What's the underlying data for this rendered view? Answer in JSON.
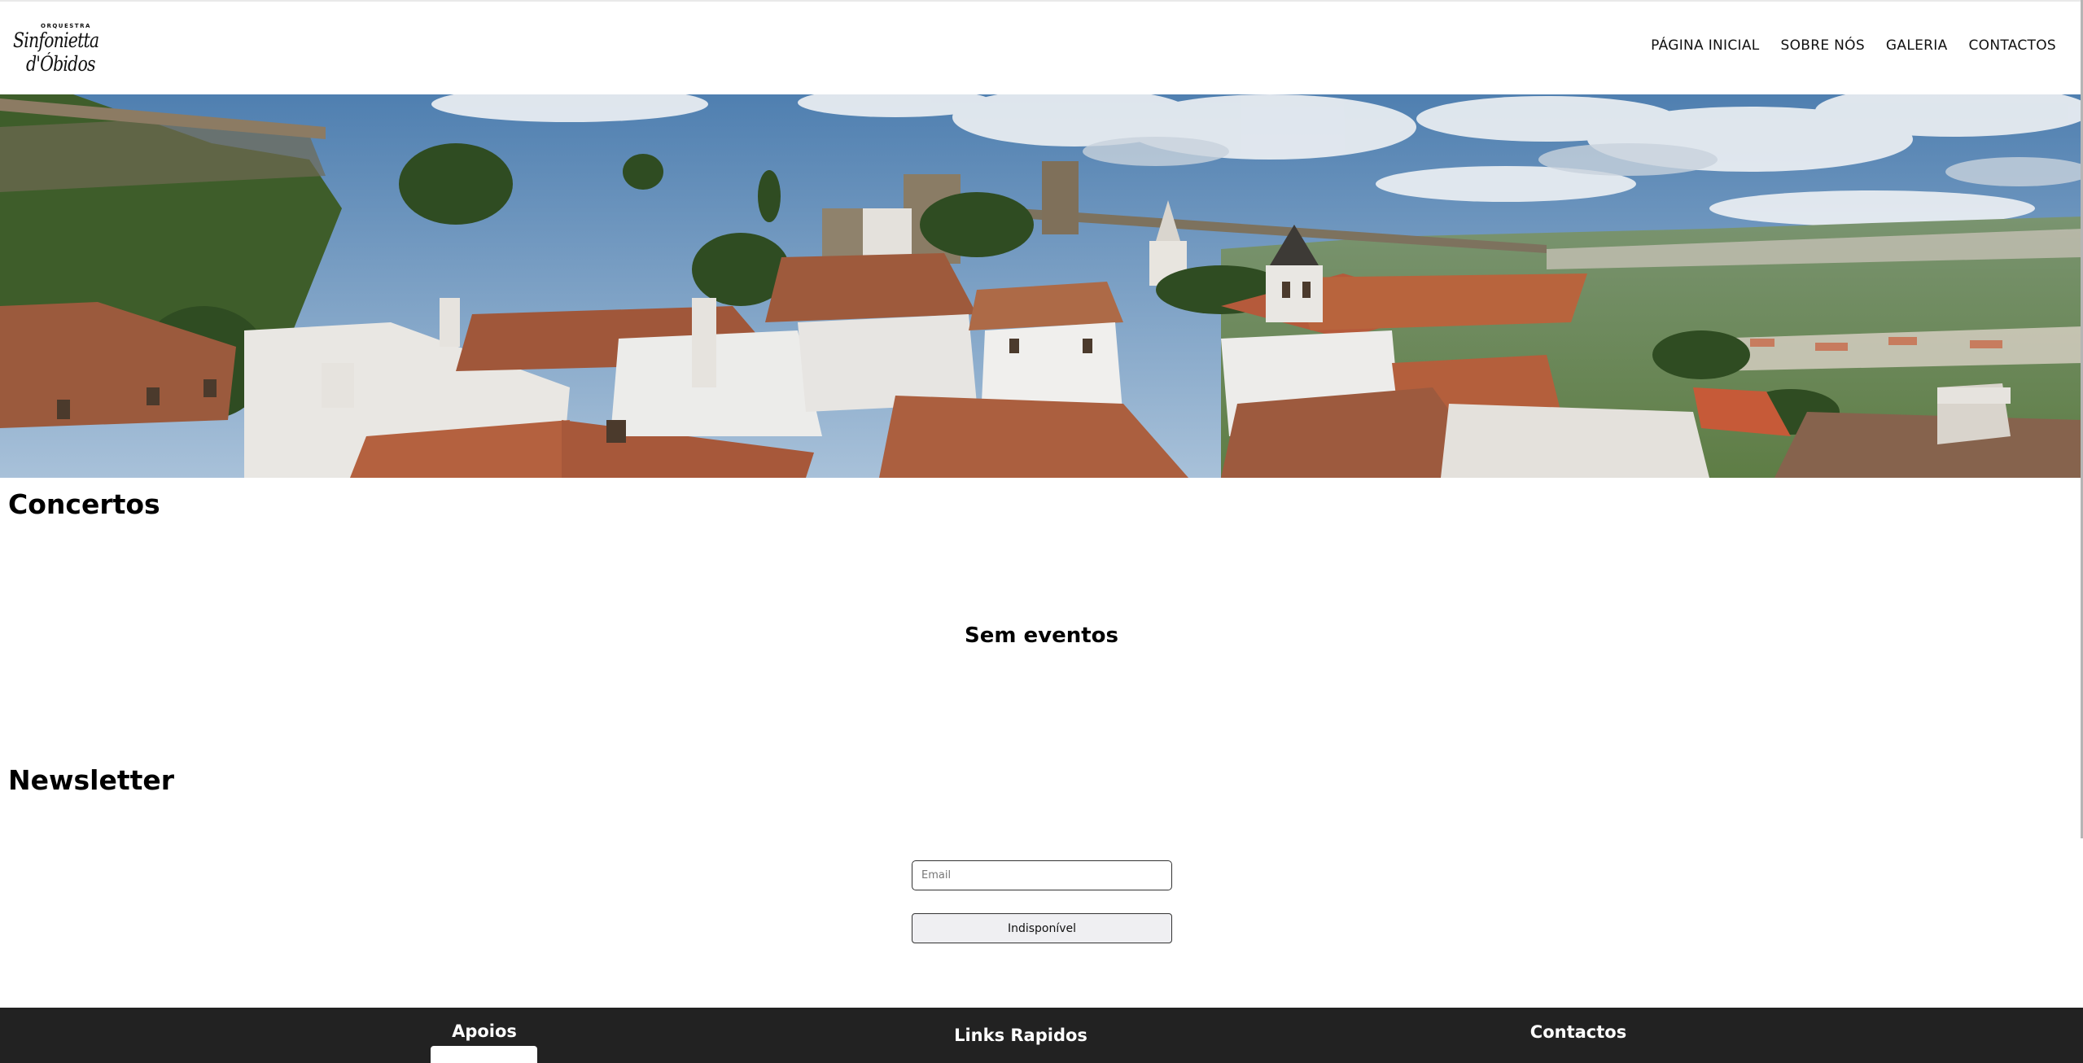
{
  "header": {
    "logo": {
      "small_text": "ORQUESTRA",
      "line1": "Sinfonietta",
      "line2": "d'Óbidos"
    },
    "nav": [
      {
        "label": "PÁGINA INICIAL"
      },
      {
        "label": "SOBRE NÓS"
      },
      {
        "label": "GALERIA"
      },
      {
        "label": "CONTACTOS"
      }
    ]
  },
  "hero": {
    "image": "landscape-photo-obidos-rooftops"
  },
  "concerts": {
    "title": "Concertos",
    "empty_message": "Sem eventos"
  },
  "newsletter": {
    "title": "Newsletter",
    "email_placeholder": "Email",
    "email_value": "",
    "button_label": "Indisponível"
  },
  "footer": {
    "columns": [
      {
        "title": "Apoios"
      },
      {
        "title": "Links Rapidos"
      },
      {
        "title": "Contactos"
      }
    ]
  },
  "colors": {
    "footer_bg": "#222222",
    "button_bg": "#efeff2",
    "sky": "#5a86b3",
    "roof": "#b5613f"
  }
}
